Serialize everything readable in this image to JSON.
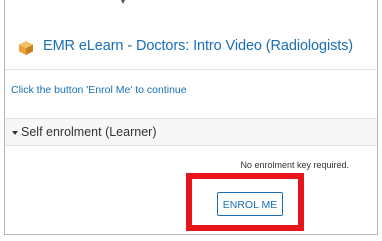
{
  "course": {
    "title": "EMR eLearn - Doctors: Intro Video (Radiologists)",
    "icon": "course-cube-icon",
    "icon_color": "#e8a23a"
  },
  "enrolment": {
    "instruction": "Click the button 'Enrol Me' to continue",
    "section_title": "Self enrolment (Learner)",
    "key_note": "No enrolment key required.",
    "button_label": "ENROL ME"
  },
  "colors": {
    "link": "#1a6fb5",
    "highlight": "#e8141b"
  }
}
